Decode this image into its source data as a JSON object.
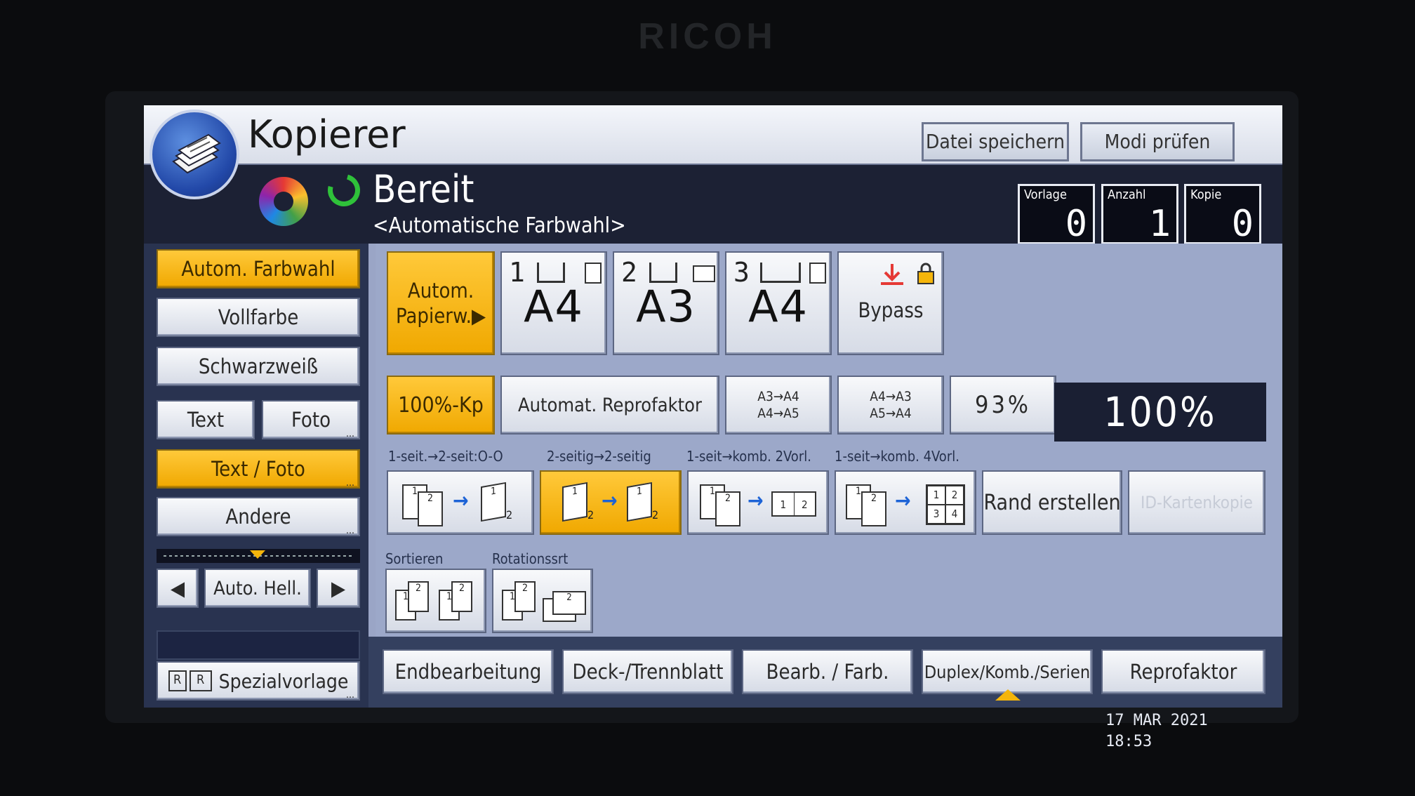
{
  "brand": "RICOH",
  "header": {
    "title": "Kopierer",
    "save_file_button": "Datei speichern",
    "check_modes_button": "Modi prüfen"
  },
  "status": {
    "text": "Bereit",
    "subtext": "<Automatische Farbwahl>"
  },
  "counters": [
    {
      "label": "Vorlage",
      "value": "0"
    },
    {
      "label": "Anzahl",
      "value": "1"
    },
    {
      "label": "Kopie",
      "value": "0"
    }
  ],
  "color_modes": [
    "Autom. Farbwahl",
    "Vollfarbe",
    "Schwarzweiß"
  ],
  "original_types": {
    "text": "Text",
    "photo": "Foto",
    "text_photo": "Text / Foto",
    "other": "Andere"
  },
  "density": {
    "label": "Auto. Hell.",
    "prev": "◀",
    "next": "▶"
  },
  "special_original": {
    "label": "Spezialvorlage",
    "icon_text": "R"
  },
  "paper": {
    "auto_line1": "Autom.",
    "auto_line2": "Papierw.",
    "auto_arrow": "▶",
    "trays": [
      {
        "num": "1",
        "size": "A4"
      },
      {
        "num": "2",
        "size": "A3"
      },
      {
        "num": "3",
        "size": "A4"
      }
    ],
    "bypass": "Bypass"
  },
  "reproduction": {
    "full_size": "100%-Kp",
    "auto_ratio": "Automat. Reprofaktor",
    "preset1": [
      "A3→A4",
      "A4→A5"
    ],
    "preset2": [
      "A4→A3",
      "A5→A4"
    ],
    "preset3": "93%",
    "current": "100%"
  },
  "duplex": {
    "labels": [
      "1-seit.→2-seit:O-O",
      "2-seitig→2-seitig",
      "1-seit→komb. 2Vorl.",
      "1-seit→komb. 4Vorl."
    ],
    "page_numbers": [
      "1",
      "2",
      "3",
      "4"
    ],
    "border": "Rand erstellen",
    "id_card": "ID-Kartenkopie"
  },
  "finishing": {
    "sort": "Sortieren",
    "rotate_sort": "Rotationssrt"
  },
  "bottom_tabs": [
    "Endbearbeitung",
    "Deck-/Trennblatt",
    "Bearb. / Farb.",
    "Duplex/Komb./Serien",
    "Reprofaktor"
  ],
  "datetime": {
    "date": "17 MAR  2021",
    "time": "18:53"
  },
  "colors": {
    "selected": "#f5b50a",
    "ready": "#2fc23a",
    "arrow": "#1d63d6",
    "status_bg": "#1c2134"
  }
}
